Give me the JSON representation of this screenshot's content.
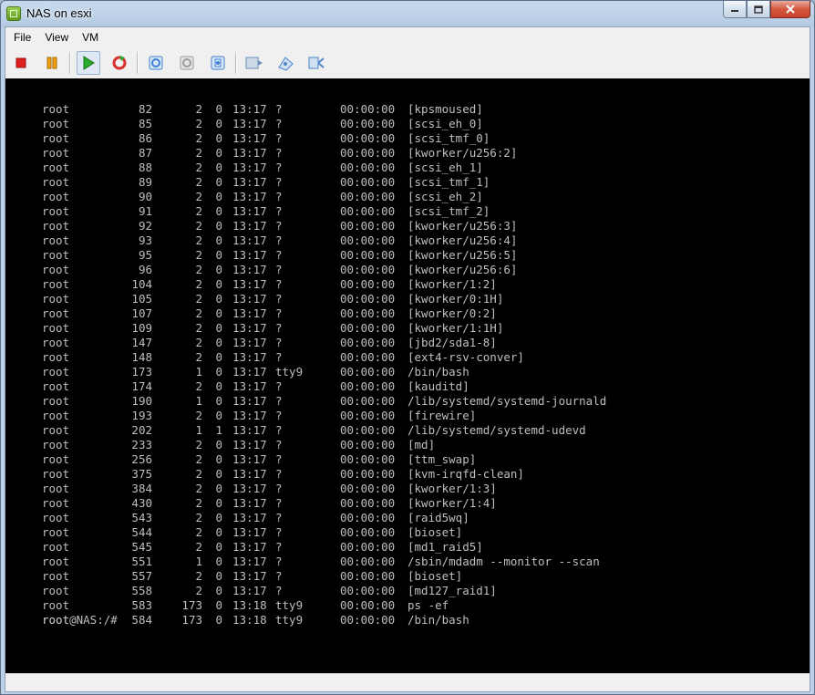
{
  "window": {
    "title": "NAS on esxi"
  },
  "menu": [
    "File",
    "View",
    "VM"
  ],
  "toolbar": [
    {
      "name": "power-off-icon",
      "color": "#e02020"
    },
    {
      "name": "suspend-icon",
      "color": "#f0a010"
    },
    {
      "name": "power-on-icon",
      "color": "#2caa2c"
    },
    {
      "name": "reset-icon",
      "color": "#d93030"
    },
    {
      "name": "snapshot-icon",
      "color": "#3f7fcf"
    },
    {
      "name": "revert-snapshot-icon",
      "color": "#9a9a9a"
    },
    {
      "name": "snapshot-manager-icon",
      "color": "#3f7fcf"
    },
    {
      "name": "cd-dvd-icon",
      "color": "#6b8fb8"
    },
    {
      "name": "floppy-icon",
      "color": "#4d86c8"
    },
    {
      "name": "network-icon",
      "color": "#4d86c8"
    }
  ],
  "console": {
    "rows": [
      {
        "user": "root",
        "pid": "82",
        "ppid": "2",
        "c": "0",
        "stime": "13:17",
        "tty": "?",
        "time": "00:00:00",
        "cmd": "[kpsmoused]"
      },
      {
        "user": "root",
        "pid": "85",
        "ppid": "2",
        "c": "0",
        "stime": "13:17",
        "tty": "?",
        "time": "00:00:00",
        "cmd": "[scsi_eh_0]"
      },
      {
        "user": "root",
        "pid": "86",
        "ppid": "2",
        "c": "0",
        "stime": "13:17",
        "tty": "?",
        "time": "00:00:00",
        "cmd": "[scsi_tmf_0]"
      },
      {
        "user": "root",
        "pid": "87",
        "ppid": "2",
        "c": "0",
        "stime": "13:17",
        "tty": "?",
        "time": "00:00:00",
        "cmd": "[kworker/u256:2]"
      },
      {
        "user": "root",
        "pid": "88",
        "ppid": "2",
        "c": "0",
        "stime": "13:17",
        "tty": "?",
        "time": "00:00:00",
        "cmd": "[scsi_eh_1]"
      },
      {
        "user": "root",
        "pid": "89",
        "ppid": "2",
        "c": "0",
        "stime": "13:17",
        "tty": "?",
        "time": "00:00:00",
        "cmd": "[scsi_tmf_1]"
      },
      {
        "user": "root",
        "pid": "90",
        "ppid": "2",
        "c": "0",
        "stime": "13:17",
        "tty": "?",
        "time": "00:00:00",
        "cmd": "[scsi_eh_2]"
      },
      {
        "user": "root",
        "pid": "91",
        "ppid": "2",
        "c": "0",
        "stime": "13:17",
        "tty": "?",
        "time": "00:00:00",
        "cmd": "[scsi_tmf_2]"
      },
      {
        "user": "root",
        "pid": "92",
        "ppid": "2",
        "c": "0",
        "stime": "13:17",
        "tty": "?",
        "time": "00:00:00",
        "cmd": "[kworker/u256:3]"
      },
      {
        "user": "root",
        "pid": "93",
        "ppid": "2",
        "c": "0",
        "stime": "13:17",
        "tty": "?",
        "time": "00:00:00",
        "cmd": "[kworker/u256:4]"
      },
      {
        "user": "root",
        "pid": "95",
        "ppid": "2",
        "c": "0",
        "stime": "13:17",
        "tty": "?",
        "time": "00:00:00",
        "cmd": "[kworker/u256:5]"
      },
      {
        "user": "root",
        "pid": "96",
        "ppid": "2",
        "c": "0",
        "stime": "13:17",
        "tty": "?",
        "time": "00:00:00",
        "cmd": "[kworker/u256:6]"
      },
      {
        "user": "root",
        "pid": "104",
        "ppid": "2",
        "c": "0",
        "stime": "13:17",
        "tty": "?",
        "time": "00:00:00",
        "cmd": "[kworker/1:2]"
      },
      {
        "user": "root",
        "pid": "105",
        "ppid": "2",
        "c": "0",
        "stime": "13:17",
        "tty": "?",
        "time": "00:00:00",
        "cmd": "[kworker/0:1H]"
      },
      {
        "user": "root",
        "pid": "107",
        "ppid": "2",
        "c": "0",
        "stime": "13:17",
        "tty": "?",
        "time": "00:00:00",
        "cmd": "[kworker/0:2]"
      },
      {
        "user": "root",
        "pid": "109",
        "ppid": "2",
        "c": "0",
        "stime": "13:17",
        "tty": "?",
        "time": "00:00:00",
        "cmd": "[kworker/1:1H]"
      },
      {
        "user": "root",
        "pid": "147",
        "ppid": "2",
        "c": "0",
        "stime": "13:17",
        "tty": "?",
        "time": "00:00:00",
        "cmd": "[jbd2/sda1-8]"
      },
      {
        "user": "root",
        "pid": "148",
        "ppid": "2",
        "c": "0",
        "stime": "13:17",
        "tty": "?",
        "time": "00:00:00",
        "cmd": "[ext4-rsv-conver]"
      },
      {
        "user": "root",
        "pid": "173",
        "ppid": "1",
        "c": "0",
        "stime": "13:17",
        "tty": "tty9",
        "time": "00:00:00",
        "cmd": "/bin/bash"
      },
      {
        "user": "root",
        "pid": "174",
        "ppid": "2",
        "c": "0",
        "stime": "13:17",
        "tty": "?",
        "time": "00:00:00",
        "cmd": "[kauditd]"
      },
      {
        "user": "root",
        "pid": "190",
        "ppid": "1",
        "c": "0",
        "stime": "13:17",
        "tty": "?",
        "time": "00:00:00",
        "cmd": "/lib/systemd/systemd-journald"
      },
      {
        "user": "root",
        "pid": "193",
        "ppid": "2",
        "c": "0",
        "stime": "13:17",
        "tty": "?",
        "time": "00:00:00",
        "cmd": "[firewire]"
      },
      {
        "user": "root",
        "pid": "202",
        "ppid": "1",
        "c": "1",
        "stime": "13:17",
        "tty": "?",
        "time": "00:00:00",
        "cmd": "/lib/systemd/systemd-udevd"
      },
      {
        "user": "root",
        "pid": "233",
        "ppid": "2",
        "c": "0",
        "stime": "13:17",
        "tty": "?",
        "time": "00:00:00",
        "cmd": "[md]"
      },
      {
        "user": "root",
        "pid": "256",
        "ppid": "2",
        "c": "0",
        "stime": "13:17",
        "tty": "?",
        "time": "00:00:00",
        "cmd": "[ttm_swap]"
      },
      {
        "user": "root",
        "pid": "375",
        "ppid": "2",
        "c": "0",
        "stime": "13:17",
        "tty": "?",
        "time": "00:00:00",
        "cmd": "[kvm-irqfd-clean]"
      },
      {
        "user": "root",
        "pid": "384",
        "ppid": "2",
        "c": "0",
        "stime": "13:17",
        "tty": "?",
        "time": "00:00:00",
        "cmd": "[kworker/1:3]"
      },
      {
        "user": "root",
        "pid": "430",
        "ppid": "2",
        "c": "0",
        "stime": "13:17",
        "tty": "?",
        "time": "00:00:00",
        "cmd": "[kworker/1:4]"
      },
      {
        "user": "root",
        "pid": "543",
        "ppid": "2",
        "c": "0",
        "stime": "13:17",
        "tty": "?",
        "time": "00:00:00",
        "cmd": "[raid5wq]"
      },
      {
        "user": "root",
        "pid": "544",
        "ppid": "2",
        "c": "0",
        "stime": "13:17",
        "tty": "?",
        "time": "00:00:00",
        "cmd": "[bioset]"
      },
      {
        "user": "root",
        "pid": "545",
        "ppid": "2",
        "c": "0",
        "stime": "13:17",
        "tty": "?",
        "time": "00:00:00",
        "cmd": "[md1_raid5]"
      },
      {
        "user": "root",
        "pid": "551",
        "ppid": "1",
        "c": "0",
        "stime": "13:17",
        "tty": "?",
        "time": "00:00:00",
        "cmd": "/sbin/mdadm --monitor --scan"
      },
      {
        "user": "root",
        "pid": "557",
        "ppid": "2",
        "c": "0",
        "stime": "13:17",
        "tty": "?",
        "time": "00:00:00",
        "cmd": "[bioset]"
      },
      {
        "user": "root",
        "pid": "558",
        "ppid": "2",
        "c": "0",
        "stime": "13:17",
        "tty": "?",
        "time": "00:00:00",
        "cmd": "[md127_raid1]"
      },
      {
        "user": "root",
        "pid": "583",
        "ppid": "173",
        "c": "0",
        "stime": "13:18",
        "tty": "tty9",
        "time": "00:00:00",
        "cmd": "ps -ef"
      },
      {
        "user": "root",
        "pid": "584",
        "ppid": "173",
        "c": "0",
        "stime": "13:18",
        "tty": "tty9",
        "time": "00:00:00",
        "cmd": "/bin/bash"
      }
    ],
    "prompt": "root@NAS:/#"
  }
}
